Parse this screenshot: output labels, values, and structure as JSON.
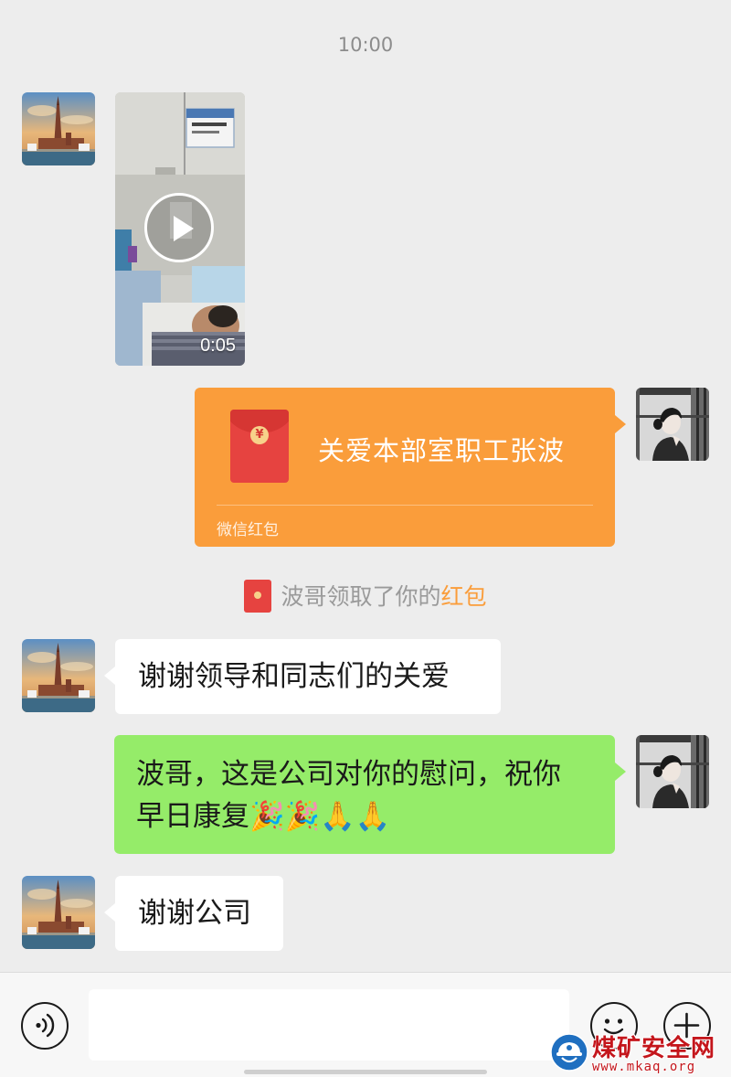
{
  "timestamp": "10:00",
  "video_message": {
    "duration": "0:05"
  },
  "red_packet": {
    "title": "关爱本部室职工张波",
    "footer": "微信红包"
  },
  "system_notice": {
    "prefix": "波哥领取了你的",
    "highlight": "红包"
  },
  "messages": [
    {
      "sender": "contact",
      "text": "谢谢领导和同志们的关爱"
    },
    {
      "sender": "self",
      "line1": "波哥，这是公司对你的慰问，祝你",
      "line2": "早日康复🎉🎉🙏🙏"
    },
    {
      "sender": "contact",
      "text": "谢谢公司"
    }
  ],
  "input_bar": {
    "voice_icon": "voice-icon",
    "emoji_icon": "emoji-icon",
    "more_icon": "plus-icon",
    "draft": ""
  },
  "watermark": {
    "title": "煤矿安全网",
    "url": "www.mkaq.org"
  },
  "colors": {
    "background": "#ededed",
    "incoming_bubble": "#ffffff",
    "outgoing_bubble": "#95ec69",
    "red_packet": "#fa9d3b",
    "highlight": "#fa9d3b"
  }
}
